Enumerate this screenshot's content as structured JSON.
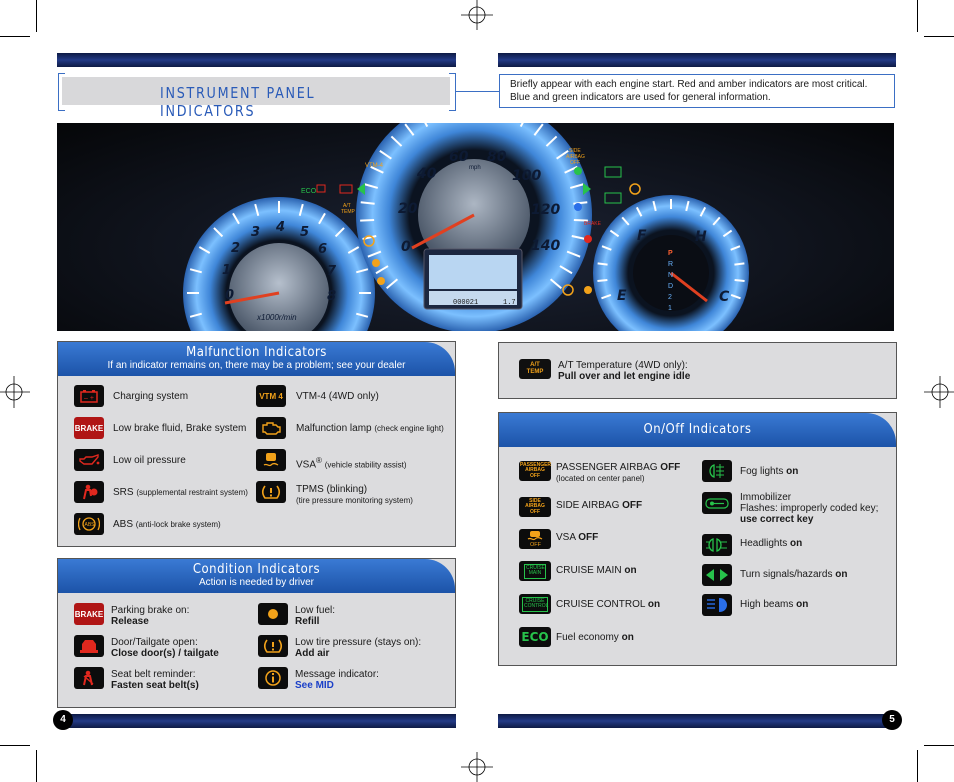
{
  "title": "INSTRUMENT PANEL INDICATORS",
  "intro": {
    "line1": "Briefly appear with each engine start. Red and amber indicators are most critical.",
    "line2": "Blue and green indicators are used for general information."
  },
  "cluster": {
    "tach_numbers": [
      "0",
      "1",
      "2",
      "3",
      "4",
      "5",
      "6",
      "7",
      "8"
    ],
    "tach_unit": "x1000r/min",
    "speed_numbers": [
      "0",
      "20",
      "40",
      "60",
      "80",
      "100",
      "120",
      "140"
    ],
    "speed_unit": "mph",
    "odometer": "000021",
    "trip": "1.7",
    "gear": [
      "P",
      "R",
      "N",
      "D",
      "2",
      "1"
    ],
    "fuel_empty": "E",
    "fuel_full": "F",
    "temp_hot": "H",
    "temp_cold": "C",
    "labels": {
      "vtm4": "VTM-4",
      "eco": "ECO",
      "at_temp": "A/T TEMP",
      "side_airbag": "SIDE AIRBAG OFF",
      "brake": "BRAKE",
      "vsa_off": "OFF"
    },
    "colors": {
      "backlight": "#5aa8ff",
      "needle": "#e04020",
      "amber": "#f2a21a",
      "green": "#27c24b",
      "red": "#e0281e"
    }
  },
  "malfunction": {
    "title": "Malfunction Indicators",
    "subtitle": "If an indicator remains on, there may be a problem; see your dealer",
    "items": [
      {
        "icon": "charging-icon",
        "label": "Charging system",
        "note": ""
      },
      {
        "icon": "vtm4-icon",
        "label": "VTM-4 (4WD only)",
        "note": "",
        "badge": "VTM 4"
      },
      {
        "icon": "brake-icon",
        "label": "Low brake fluid, Brake system",
        "note": "",
        "badge": "BRAKE"
      },
      {
        "icon": "engine-icon",
        "label": "Malfunction lamp",
        "note": "(check engine light)"
      },
      {
        "icon": "oil-icon",
        "label": "Low oil pressure",
        "note": ""
      },
      {
        "icon": "vsa-icon",
        "label": "VSA",
        "note": "(vehicle stability assist)",
        "sup": "®"
      },
      {
        "icon": "srs-icon",
        "label": "SRS",
        "note": "(supplemental restraint system)"
      },
      {
        "icon": "tpms-icon",
        "label": "TPMS (blinking)",
        "note": "(tire pressure monitoring system)"
      },
      {
        "icon": "abs-icon",
        "label": "ABS",
        "note": "(anti-lock brake system)",
        "badge": "ABS"
      }
    ]
  },
  "condition": {
    "title": "Condition Indicators",
    "subtitle": "Action is needed by driver",
    "items": [
      {
        "icon": "parking-brake-icon",
        "label": "Parking brake on:",
        "action": "Release",
        "badge": "BRAKE"
      },
      {
        "icon": "low-fuel-icon",
        "label": "Low fuel:",
        "action": "Refill"
      },
      {
        "icon": "door-open-icon",
        "label": "Door/Tailgate open:",
        "action": "Close door(s) / tailgate"
      },
      {
        "icon": "low-tire-icon",
        "label": "Low tire pressure (stays on):",
        "action": "Add air"
      },
      {
        "icon": "seatbelt-icon",
        "label": "Seat belt reminder:",
        "action": "Fasten seat belt(s)"
      },
      {
        "icon": "message-icon",
        "label": "Message indicator:",
        "action": "See MID"
      }
    ]
  },
  "at_temp": {
    "badge": "A/T TEMP",
    "label": "A/T Temperature (4WD only):",
    "action": "Pull over and let engine idle"
  },
  "onoff": {
    "title": "On/Off Indicators",
    "left": [
      {
        "icon": "passenger-airbag-icon",
        "badge": "PASSENGER AIRBAG OFF",
        "label": "PASSENGER AIRBAG",
        "bold": "OFF",
        "note": "(located on center panel)"
      },
      {
        "icon": "side-airbag-icon",
        "badge": "SIDE AIRBAG OFF",
        "label": "SIDE AIRBAG",
        "bold": "OFF",
        "note": ""
      },
      {
        "icon": "vsa-off-icon",
        "badge": "OFF",
        "label": "VSA",
        "bold": "OFF",
        "note": ""
      },
      {
        "icon": "cruise-main-icon",
        "badge": "CRUISE MAIN",
        "label": "CRUISE MAIN",
        "bold": "on",
        "note": ""
      },
      {
        "icon": "cruise-control-icon",
        "badge": "CRUISE CONTROL",
        "label": "CRUISE CONTROL",
        "bold": "on",
        "note": ""
      },
      {
        "icon": "eco-icon",
        "badge": "ECO",
        "label": "Fuel economy",
        "bold": "on",
        "note": ""
      }
    ],
    "right": [
      {
        "icon": "fog-lights-icon",
        "label": "Fog lights",
        "bold": "on"
      },
      {
        "icon": "immobilizer-icon",
        "label": "Immobilizer",
        "line2": "Flashes: improperly coded key;",
        "bold2": "use correct key"
      },
      {
        "icon": "headlights-icon",
        "label": "Headlights",
        "bold": "on"
      },
      {
        "icon": "turn-signals-icon",
        "label": "Turn signals/hazards",
        "bold": "on"
      },
      {
        "icon": "high-beams-icon",
        "label": "High beams",
        "bold": "on"
      }
    ]
  },
  "pages": {
    "left": "4",
    "right": "5"
  }
}
